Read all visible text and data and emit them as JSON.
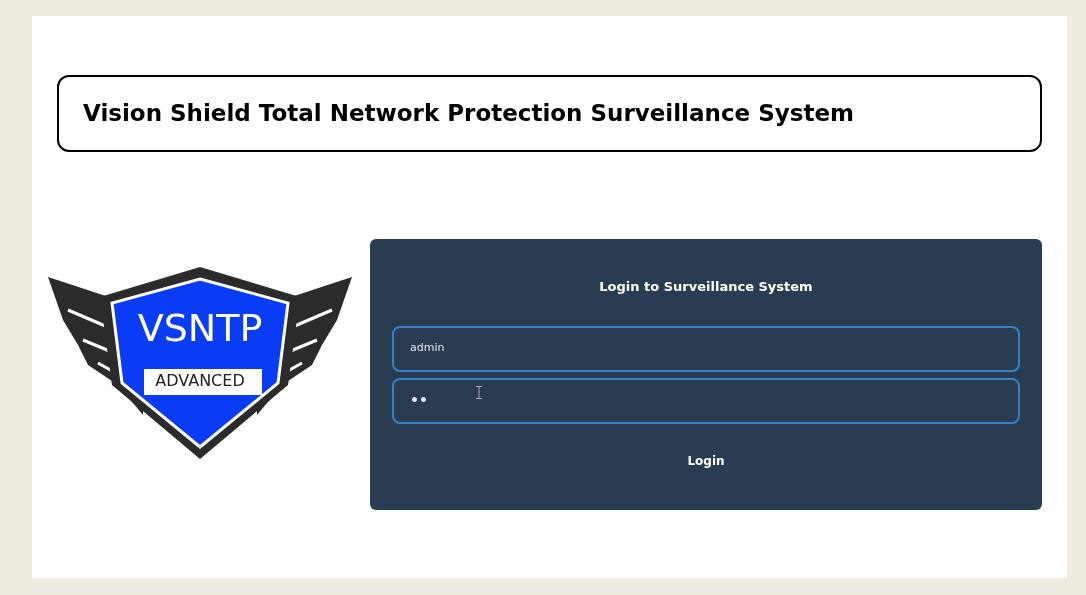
{
  "header": {
    "title": "Vision Shield Total Network Protection Surveillance System"
  },
  "logo": {
    "name": "VSNTP",
    "tagline": "ADVANCED"
  },
  "login": {
    "heading": "Login to Surveillance System",
    "fields": [
      {
        "kind": "text",
        "value": "admin"
      },
      {
        "kind": "password",
        "value": "••"
      }
    ],
    "button": "Login"
  }
}
